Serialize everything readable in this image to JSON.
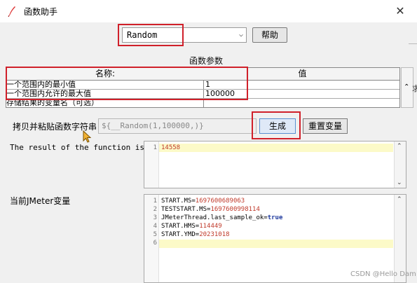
{
  "window": {
    "title": "函数助手",
    "close_glyph": "✕"
  },
  "function_select": {
    "value": "Random",
    "arrow": "⌵"
  },
  "help_button": "帮助",
  "params_label": "函数参数",
  "table": {
    "headers": [
      "名称:",
      "值"
    ],
    "rows": [
      {
        "name": "一个范围内的最小值",
        "value": "1"
      },
      {
        "name": "一个范围内允许的最大值",
        "value": "100000"
      },
      {
        "name": "存储结果的变量名（可选）",
        "value": ""
      }
    ]
  },
  "copy_row": {
    "label": "拷贝并粘贴函数字符串",
    "formula": "${__Random(1,100000,)}",
    "generate_button": "生成",
    "reset_button": "重置变量"
  },
  "result": {
    "label": "The result of the function is",
    "lines": [
      {
        "n": "1",
        "text": "14558"
      }
    ]
  },
  "vars": {
    "label": "当前JMeter变量",
    "lines": [
      {
        "n": "1",
        "key": "START.MS=",
        "val": "1697600689063"
      },
      {
        "n": "2",
        "key": "TESTSTART.MS=",
        "val": "1697600998114"
      },
      {
        "n": "3",
        "key": "JMeterThread.last_sample_ok=",
        "val": "true"
      },
      {
        "n": "4",
        "key": "START.HMS=",
        "val": "114449"
      },
      {
        "n": "5",
        "key": "START.YMD=",
        "val": "20231018"
      },
      {
        "n": "6",
        "key": "",
        "val": ""
      }
    ]
  },
  "edge_text": "求",
  "watermark": "CSDN @Hello Dam",
  "colors": {
    "highlight_border": "#d0202a",
    "line_highlight": "#fcfac8",
    "number": "#c03a2b",
    "keyword": "#1f3a9e"
  },
  "icons": {
    "app": "feather-pen-icon",
    "cursor": "mouse-pointer-icon"
  }
}
